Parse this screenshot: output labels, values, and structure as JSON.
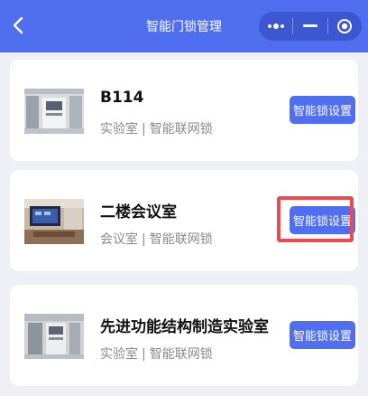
{
  "header": {
    "title": "智能门锁管理"
  },
  "rooms": [
    {
      "name": "B114",
      "type": "实验室",
      "divider": "|",
      "category": "智能联网锁",
      "button_label": "智能锁设置"
    },
    {
      "name": "二楼会议室",
      "type": "会议室",
      "divider": "|",
      "category": "智能联网锁",
      "button_label": "智能锁设置"
    },
    {
      "name": "先进功能结构制造实验室",
      "type": "实验室",
      "divider": "|",
      "category": "智能联网锁",
      "button_label": "智能锁设置"
    }
  ],
  "colors": {
    "accent": "#4f6ef0",
    "highlight": "#ec4a4f",
    "background": "#eef0f6"
  },
  "icons": [
    "back-arrow-icon",
    "more-dots-icon",
    "minimize-icon",
    "close-target-icon"
  ]
}
